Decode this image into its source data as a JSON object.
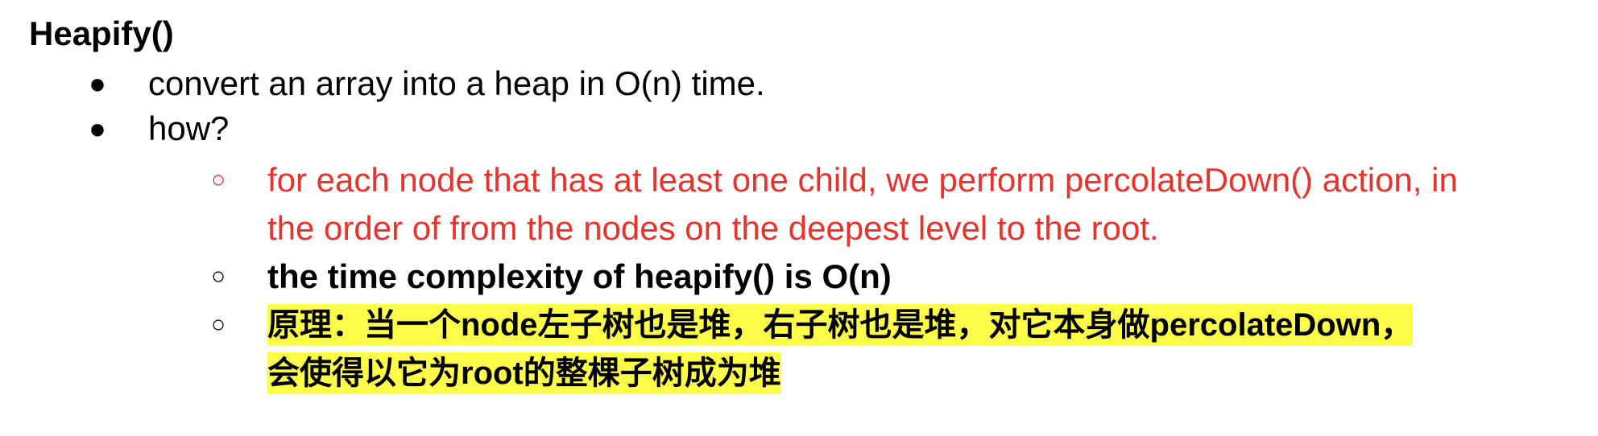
{
  "heading": "Heapify()",
  "bullets": [
    {
      "marker": "●",
      "text": "convert an array into a heap in O(n) time."
    },
    {
      "marker": "●",
      "text": "how?"
    }
  ],
  "sub_bullets": [
    {
      "marker": "○",
      "lines": [
        "for each node that has at least one child, we perform percolateDown() action, in",
        "the order of from the nodes on the deepest level to the root."
      ],
      "color": "#e8322c"
    },
    {
      "marker": "○",
      "text": "the time complexity of heapify() is O(n)"
    },
    {
      "marker": "○",
      "lines": [
        " 原理：当一个node左子树也是堆，右子树也是堆，对它本身做percolateDown，",
        "会使得以它为root的整棵子树成为堆"
      ],
      "highlight": "#fdfd49"
    }
  ]
}
